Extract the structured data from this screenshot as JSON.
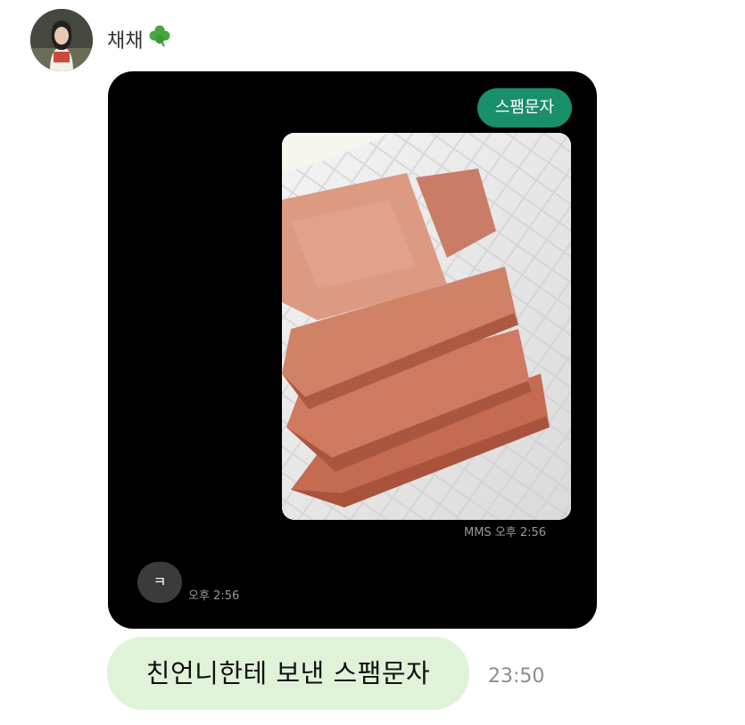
{
  "header": {
    "sender_name": "채채",
    "avatar": "profile-photo",
    "emoji": "four-leaf-clover"
  },
  "screenshot": {
    "spam_bubble_text": "스팸문자",
    "photo": "sliced-spam-on-plate",
    "photo_time": "MMS 오후 2:56",
    "reply_text": "ㅋ",
    "reply_time": "오후 2:56"
  },
  "message": {
    "text": "친언니한테 보낸 스팸문자",
    "time": "23:50"
  },
  "colors": {
    "bubble_green": "#1a8f6c",
    "caption_bubble": "#dff3d8",
    "card_bg": "#000000"
  }
}
